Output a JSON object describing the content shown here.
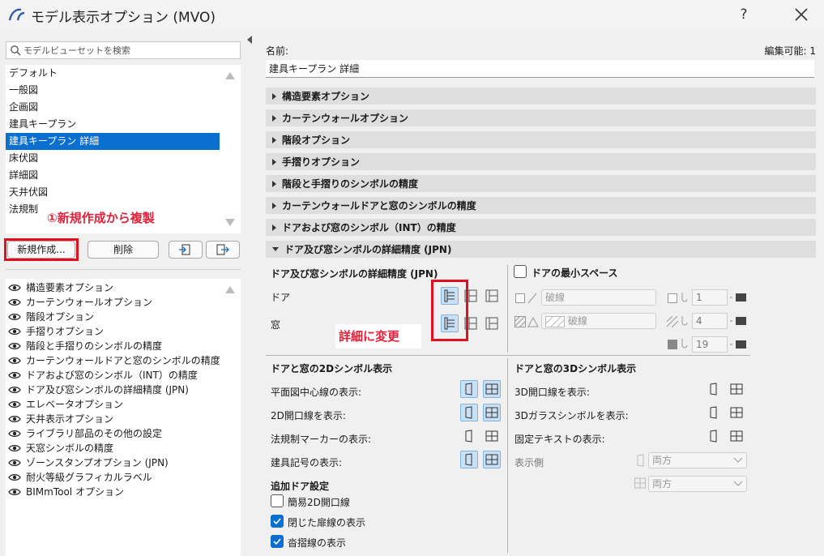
{
  "window": {
    "title": "モデル表示オプション (MVO)",
    "help": "?"
  },
  "left": {
    "search_placeholder": "モデルビューセットを検索",
    "view_sets": [
      "デフォルト",
      "一般図",
      "企画図",
      "建具キープラン",
      "建具キープラン 詳細",
      "床伏図",
      "詳細図",
      "天井伏図",
      "法規制"
    ],
    "selected_index": 4,
    "annotation_1": "①新規作成から複製",
    "buttons": {
      "new": "新規作成...",
      "delete": "削除"
    },
    "options": [
      "構造要素オプション",
      "カーテンウォールオプション",
      "階段オプション",
      "手摺りオプション",
      "階段と手摺りのシンボルの精度",
      "カーテンウォールドアと窓のシンボルの精度",
      "ドアおよび窓のシンボル（INT）の精度",
      "ドア及び窓シンボルの詳細精度 (JPN)",
      "エレベータオプション",
      "天井表示オプション",
      "ライブラリ部品のその他の設定",
      "天窓シンボルの精度",
      "ゾーンスタンプオプション (JPN)",
      "耐火等級グラフィカルラベル",
      "BIMmTool オプション"
    ]
  },
  "right": {
    "name_label": "名前:",
    "editable_label": "編集可能: 1",
    "name_value": "建具キープラン 詳細",
    "sections": [
      "構造要素オプション",
      "カーテンウォールオプション",
      "階段オプション",
      "手摺りオプション",
      "階段と手摺りのシンボルの精度",
      "カーテンウォールドアと窓のシンボルの精度",
      "ドアおよび窓のシンボル（INT）の精度",
      "ドア及び窓シンボルの詳細精度 (JPN)"
    ],
    "detail": {
      "title": "ドア及び窓シンボルの詳細精度 (JPN)",
      "door": "ドア",
      "window": "窓",
      "annotation_2": "詳細に変更",
      "min_space_label": "ドアの最小スペース",
      "line_type_1": "破線",
      "line_type_2": "破線",
      "pen_1": "1",
      "pen_2": "4",
      "pen_3": "19"
    },
    "sym2d": {
      "title": "ドアと窓の2Dシンボル表示",
      "rows": [
        "平面図中心線の表示:",
        "2D開口線を表示:",
        "法規制マーカーの表示:",
        "建具記号の表示:"
      ]
    },
    "sym3d": {
      "title": "ドアと窓の3Dシンボル表示",
      "rows": [
        "3D開口線を表示:",
        "3Dガラスシンボルを表示:",
        "固定テキストの表示:"
      ],
      "display_side_label": "表示側",
      "combo_1": "両方",
      "combo_2": "両方"
    },
    "extra": {
      "title": "追加ドア設定",
      "checks": [
        {
          "label": "簡易2D開口線",
          "checked": false
        },
        {
          "label": "閉じた扉線の表示",
          "checked": true
        },
        {
          "label": "沓摺線の表示",
          "checked": true
        }
      ]
    }
  }
}
